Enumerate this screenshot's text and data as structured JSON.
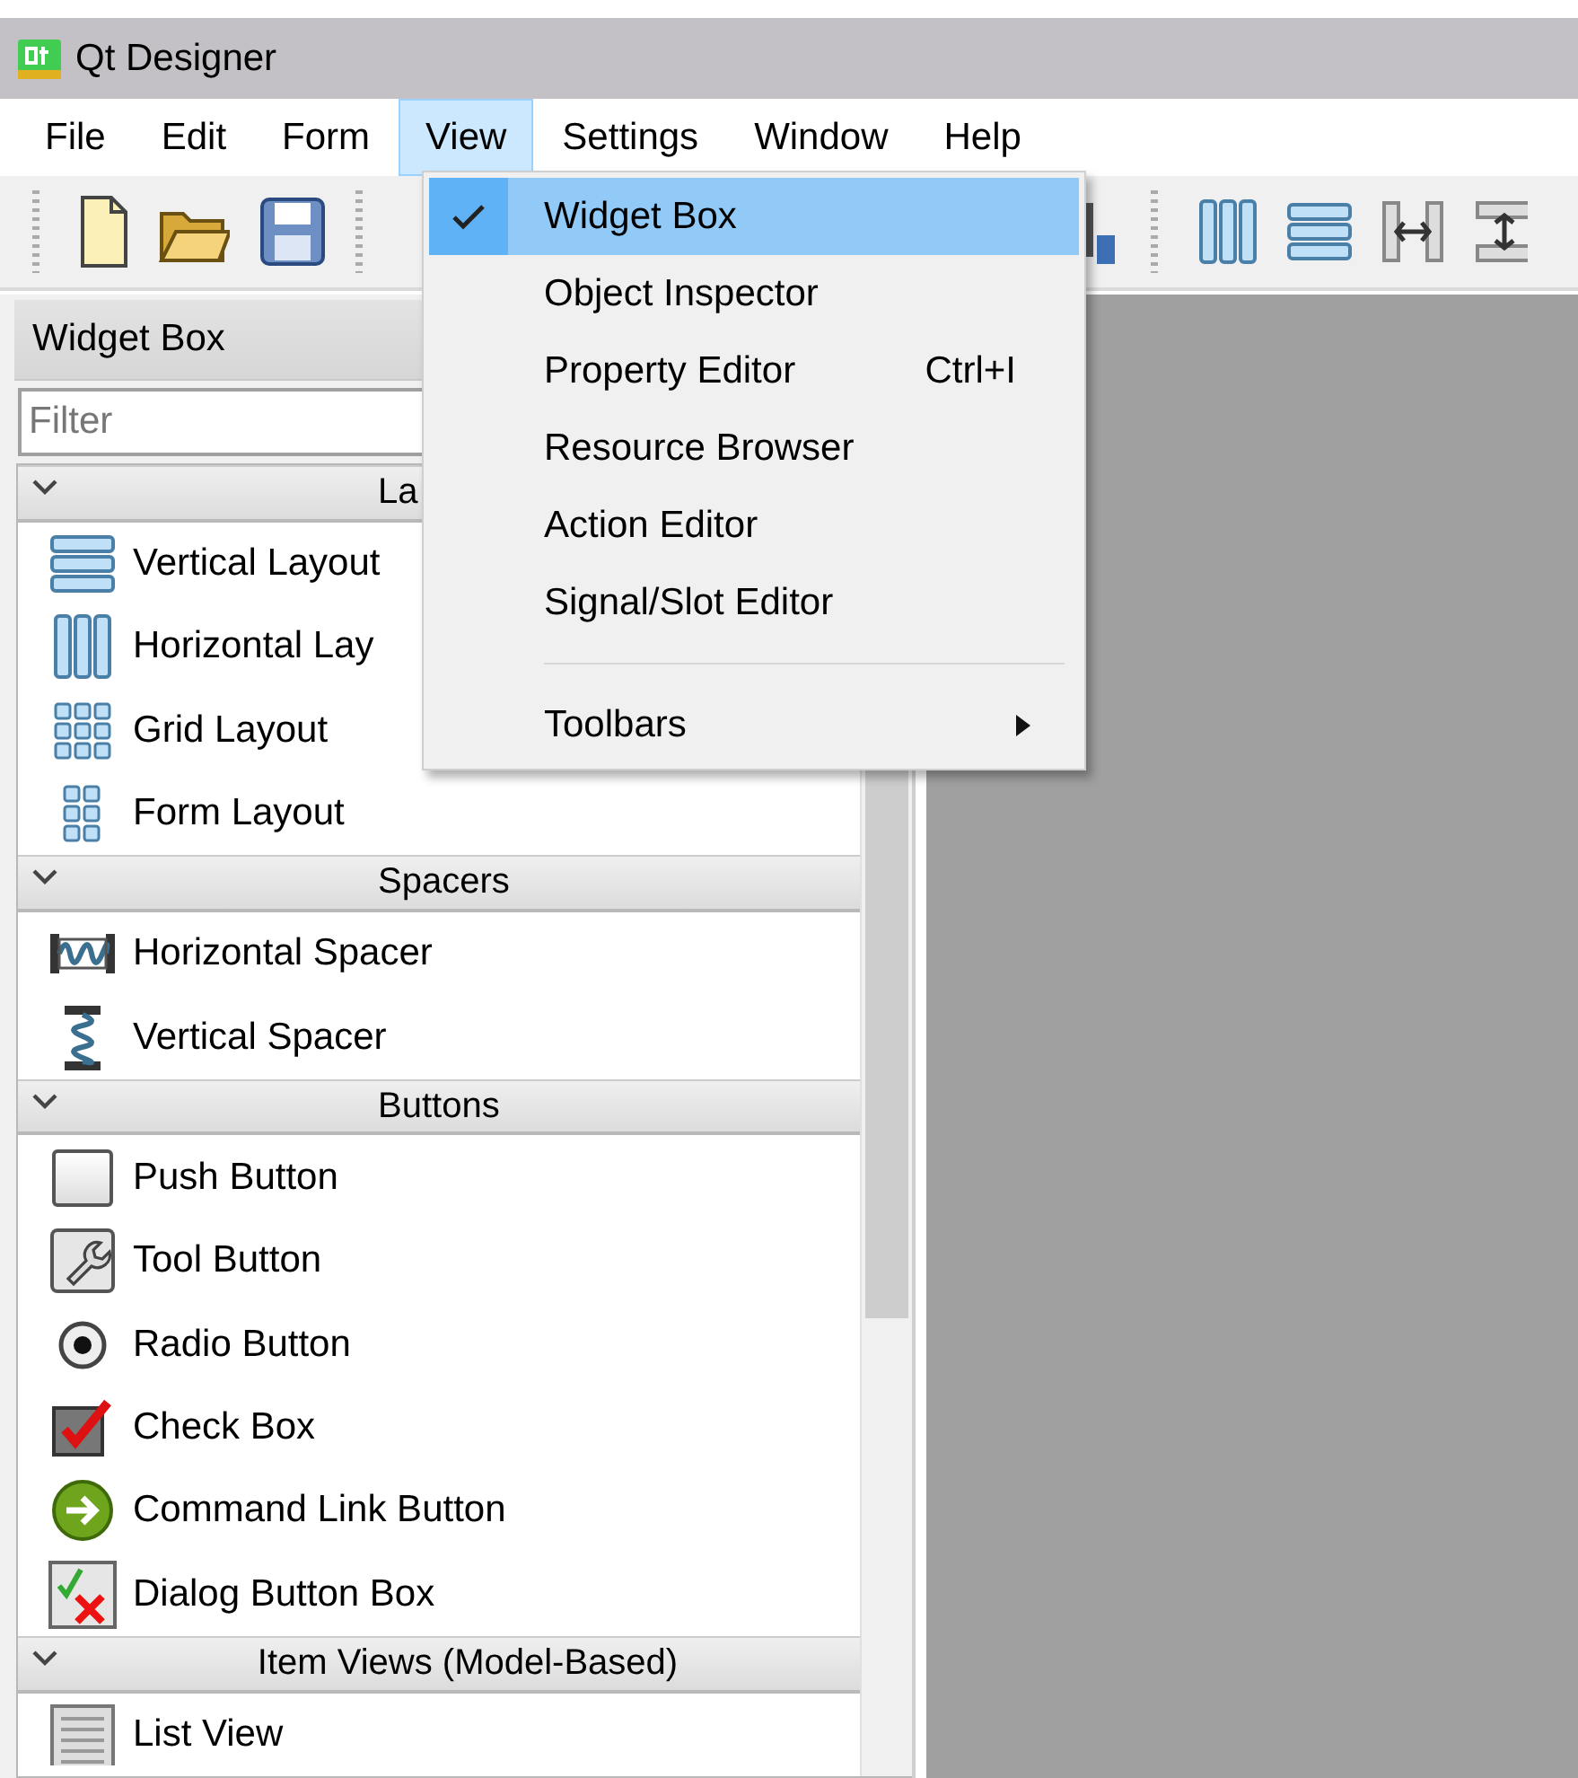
{
  "window": {
    "title": "Qt Designer"
  },
  "menu_bar": [
    {
      "label": "File",
      "selected": false
    },
    {
      "label": "Edit",
      "selected": false
    },
    {
      "label": "Form",
      "selected": false
    },
    {
      "label": "View",
      "selected": true
    },
    {
      "label": "Settings",
      "selected": false
    },
    {
      "label": "Window",
      "selected": false
    },
    {
      "label": "Help",
      "selected": false
    }
  ],
  "view_menu": [
    {
      "kind": "action",
      "label": "Widget Box",
      "checked": true,
      "selected": true
    },
    {
      "kind": "action",
      "label": "Object Inspector",
      "checked": false,
      "selected": false
    },
    {
      "kind": "action",
      "label": "Property Editor",
      "shortcut": "Ctrl+I",
      "checked": false,
      "selected": false
    },
    {
      "kind": "action",
      "label": "Resource Browser",
      "checked": false,
      "selected": false
    },
    {
      "kind": "action",
      "label": "Action Editor",
      "checked": false,
      "selected": false
    },
    {
      "kind": "action",
      "label": "Signal/Slot Editor",
      "checked": false,
      "selected": false
    },
    {
      "kind": "separator"
    },
    {
      "kind": "submenu",
      "label": "Toolbars",
      "checked": false,
      "selected": false
    }
  ],
  "widget_box": {
    "title": "Widget Box",
    "filter": {
      "placeholder": "Filter"
    },
    "categories": [
      {
        "label": "La",
        "expanded": true,
        "items": [
          "Vertical Layout",
          "Horizontal Lay",
          "Grid Layout",
          "Form Layout"
        ]
      },
      {
        "label": "Spacers",
        "expanded": true,
        "items": [
          "Horizontal Spacer",
          "Vertical Spacer"
        ]
      },
      {
        "label": "Buttons",
        "expanded": true,
        "items": [
          "Push Button",
          "Tool Button",
          "Radio Button",
          "Check Box",
          "Command Link Button",
          "Dialog Button Box"
        ]
      },
      {
        "label": "Item Views (Model-Based)",
        "expanded": true,
        "items": [
          "List View"
        ]
      }
    ]
  }
}
